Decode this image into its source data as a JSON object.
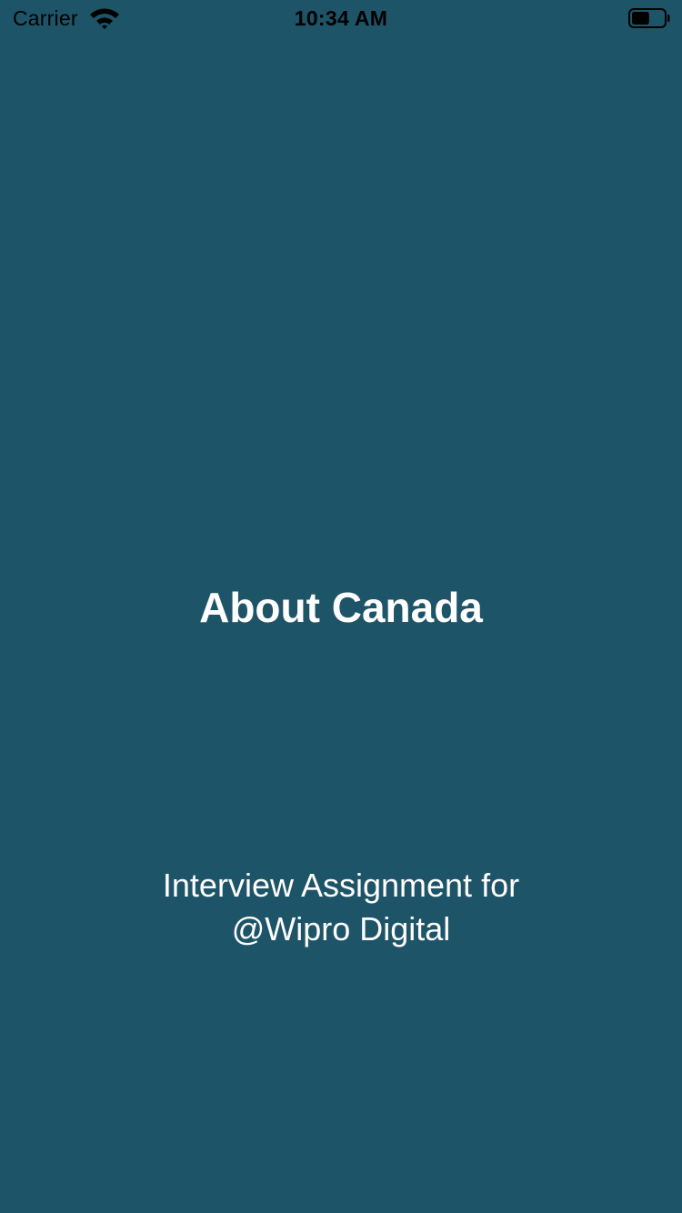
{
  "status_bar": {
    "carrier": "Carrier",
    "time": "10:34 AM",
    "wifi_icon": "wifi-icon",
    "battery_icon": "battery-icon",
    "battery_level": 0.55
  },
  "splash": {
    "title": "About Canada",
    "subtitle_line1": "Interview Assignment for",
    "subtitle_line2": "@Wipro Digital"
  },
  "colors": {
    "background": "#1e5467",
    "text": "#ffffff",
    "status_text": "#000000"
  }
}
